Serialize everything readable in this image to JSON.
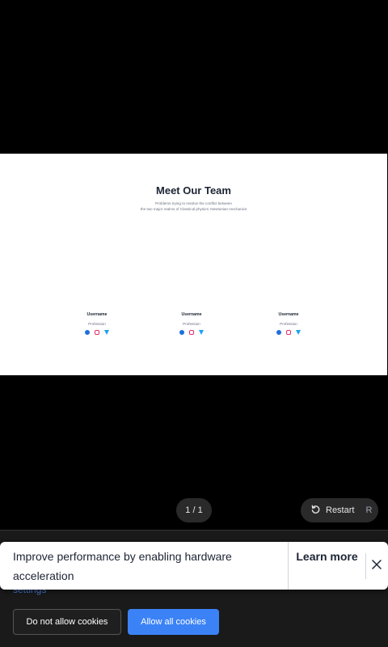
{
  "slide": {
    "title": "Meet Our Team",
    "subtitle_line1": "Problems trying to resolve the conflict between",
    "subtitle_line2": "the two major realms of Classical physics: Newtonian mechanics",
    "members": [
      {
        "username": "Username",
        "profession": "Profession"
      },
      {
        "username": "Username",
        "profession": "Profession"
      },
      {
        "username": "Username",
        "profession": "Profession"
      }
    ],
    "social_icons": [
      "facebook-icon",
      "instagram-icon",
      "twitter-icon"
    ]
  },
  "controls": {
    "page_indicator": "1 / 1",
    "restart_label": "Restart",
    "restart_key": "R"
  },
  "toast": {
    "message": "Improve performance by enabling hardware acceleration",
    "learn_more": "Learn more",
    "close_icon": "close-icon"
  },
  "cookie": {
    "settings_link": "settings",
    "deny_label": "Do not allow cookies",
    "allow_label": "Allow all cookies"
  },
  "colors": {
    "accent": "#3b82f6",
    "facebook": "#1d6fe0",
    "instagram": "#e1306c",
    "twitter": "#1da1f2"
  }
}
